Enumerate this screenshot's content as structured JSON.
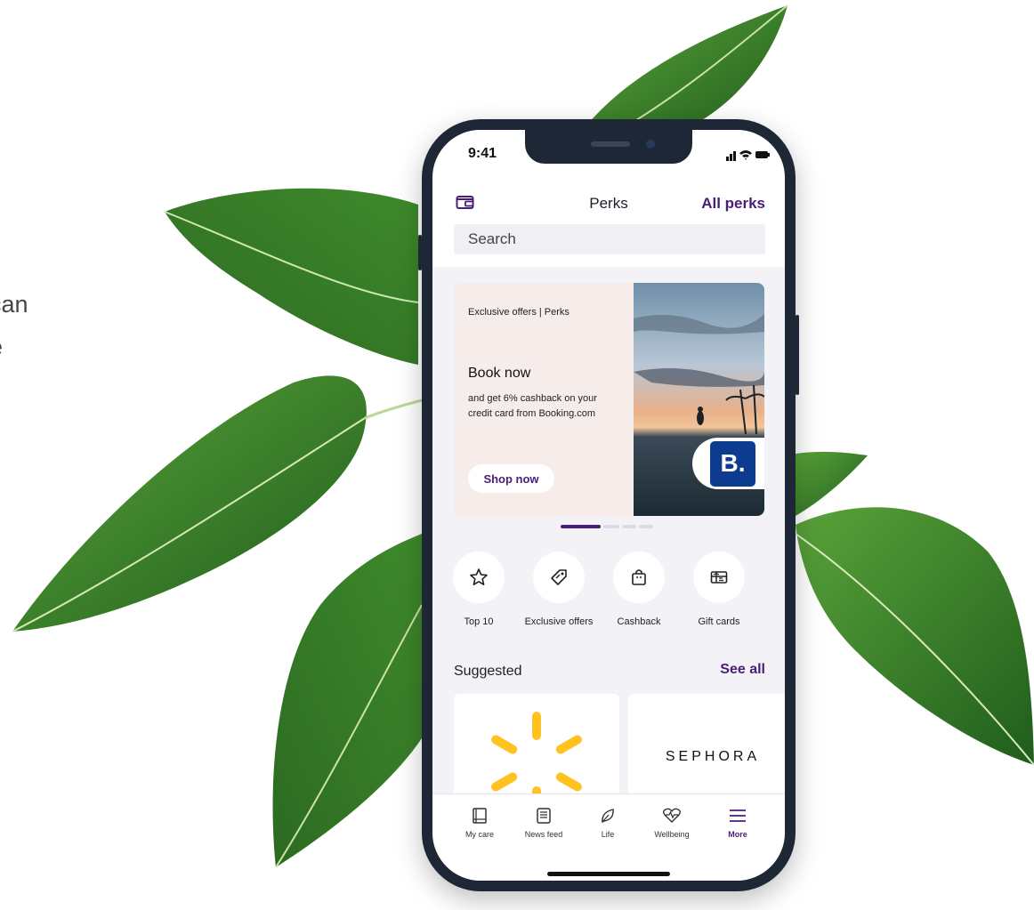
{
  "side_text": {
    "line1": "can",
    "line2": "e"
  },
  "status_bar": {
    "time": "9:41"
  },
  "header": {
    "title": "Perks",
    "all_perks": "All perks",
    "wallet_icon": "wallet-icon"
  },
  "search": {
    "placeholder": "Search"
  },
  "banner": {
    "tag": "Exclusive offers | Perks",
    "headline": "Book now",
    "description": "and get 6% cashback on your credit card from Booking.com",
    "button": "Shop now",
    "logo_text": "B.",
    "carousel_pages": 4,
    "carousel_active": 1
  },
  "categories": [
    {
      "label": "Top 10",
      "icon": "star-icon"
    },
    {
      "label": "Exclusive offers",
      "icon": "tag-icon"
    },
    {
      "label": "Cashback",
      "icon": "shopping-bag-icon"
    },
    {
      "label": "Gift cards",
      "icon": "gift-card-icon"
    }
  ],
  "suggested": {
    "title": "Suggested",
    "see_all": "See all",
    "cards": [
      "walmart-spark-logo",
      "SEPHORA"
    ]
  },
  "tabbar": [
    {
      "label": "My care",
      "icon": "book-icon"
    },
    {
      "label": "News feed",
      "icon": "news-icon"
    },
    {
      "label": "Life",
      "icon": "leaf-icon"
    },
    {
      "label": "Wellbeing",
      "icon": "heart-pulse-icon"
    },
    {
      "label": "More",
      "icon": "menu-icon",
      "active": true
    }
  ],
  "colors": {
    "accent": "#4a1d78",
    "phone_frame": "#1d2735",
    "banner_bg": "#f6ecea",
    "booking_blue": "#0c3b8f",
    "walmart_yellow": "#ffc220"
  }
}
